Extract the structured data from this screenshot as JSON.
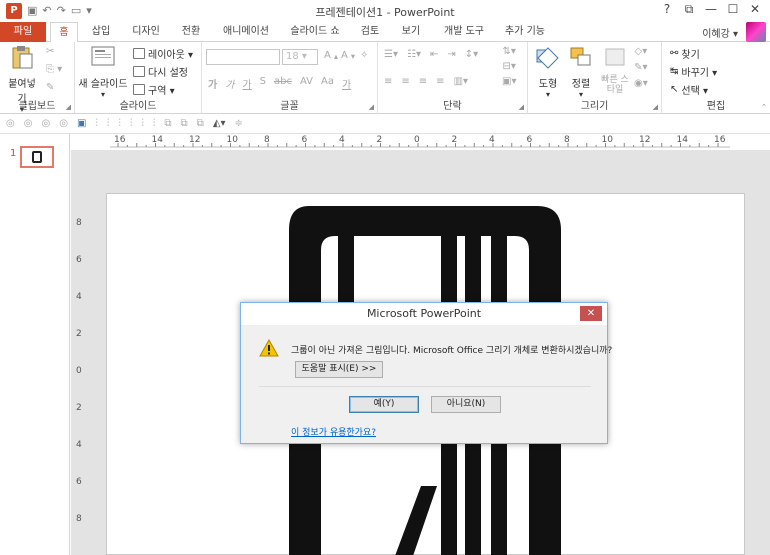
{
  "window": {
    "title": "프레젠테이션1 - PowerPoint",
    "app_icon": "P",
    "controls": [
      "?",
      "⧉",
      "—",
      "☐",
      "✕"
    ]
  },
  "tabs": [
    {
      "label": "파일",
      "kind": "file"
    },
    {
      "label": "홈",
      "active": true
    },
    {
      "label": "삽입"
    },
    {
      "label": "디자인"
    },
    {
      "label": "전환"
    },
    {
      "label": "애니메이션"
    },
    {
      "label": "슬라이드 쇼"
    },
    {
      "label": "검토"
    },
    {
      "label": "보기"
    },
    {
      "label": "개발 도구"
    },
    {
      "label": "추가 기능"
    }
  ],
  "user": {
    "name": "이혜강 ▾"
  },
  "ribbon": {
    "clipboard": {
      "label": "클립보드",
      "paste": "붙여넣기"
    },
    "slides": {
      "label": "슬라이드",
      "new_slide": "새 슬라이드",
      "layout": "레이아웃 ▾",
      "reset": "다시 설정",
      "section": "구역 ▾"
    },
    "font": {
      "label": "글꼴",
      "size": "18",
      "letters": [
        "가",
        "가",
        "가",
        "S",
        "abc",
        "AV",
        "Aa",
        "가"
      ]
    },
    "paragraph": {
      "label": "단락"
    },
    "drawing": {
      "label": "그리기",
      "shapes": "도형",
      "arrange": "정렬",
      "quick_styles": "빠른 스타일"
    },
    "editing": {
      "label": "편집",
      "find": "찾기",
      "replace": "바꾸기 ▾",
      "select": "선택 ▾"
    }
  },
  "slide_pane": {
    "number": "1"
  },
  "ruler": {
    "h_labels": [
      "16",
      "14",
      "12",
      "10",
      "8",
      "6",
      "4",
      "2",
      "0",
      "2",
      "4",
      "6",
      "8",
      "10",
      "12",
      "14",
      "16"
    ],
    "v_labels": [
      "8",
      "6",
      "4",
      "2",
      "0",
      "2",
      "4",
      "6",
      "8"
    ]
  },
  "dialog": {
    "title": "Microsoft PowerPoint",
    "close": "✕",
    "message": "그룹이 아닌 가져온 그림입니다. Microsoft Office 그리기 개체로 변환하시겠습니까?",
    "help_button": "도움말 표시(E) >>",
    "yes_button": "예(Y)",
    "no_button": "아니요(N)",
    "feedback_link": "이 정보가 유용한가요?"
  },
  "colors": {
    "accent": "#d24726",
    "dialog_border": "#7eb4ea",
    "close_red": "#c75050",
    "link": "#0066cc"
  }
}
